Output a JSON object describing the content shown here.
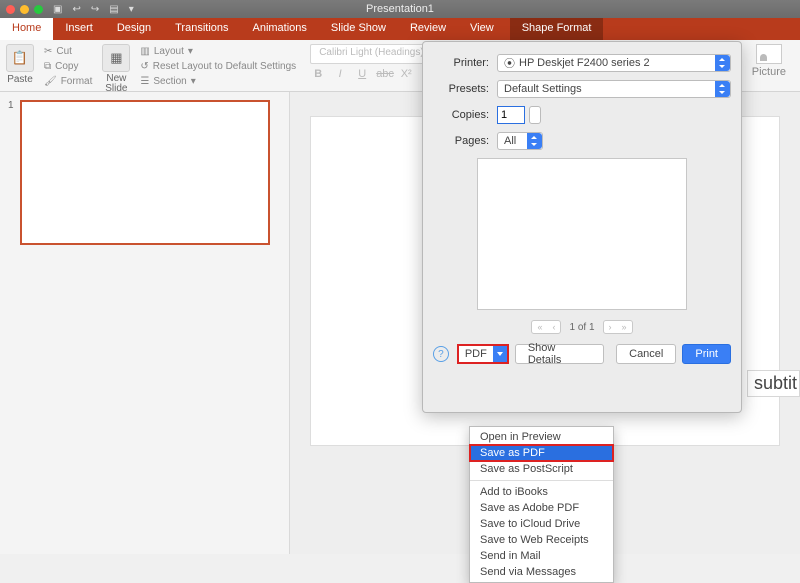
{
  "title": "Presentation1",
  "tabs": {
    "home": "Home",
    "insert": "Insert",
    "design": "Design",
    "transitions": "Transitions",
    "animations": "Animations",
    "slideshow": "Slide Show",
    "review": "Review",
    "view": "View",
    "shapeformat": "Shape Format"
  },
  "ribbon": {
    "paste": "Paste",
    "cut": "Cut",
    "copy": "Copy",
    "format": "Format",
    "newslide": "New\nSlide",
    "layout": "Layout",
    "reset": "Reset Layout to Default Settings",
    "section": "Section",
    "font": "Calibri Light (Headings)",
    "picture": "Picture",
    "b": "B",
    "i": "I",
    "u": "U",
    "s": "abc",
    "x2": "X²"
  },
  "thumb_num": "1",
  "subtitle": "subtit",
  "print": {
    "printer_label": "Printer:",
    "printer": "HP Deskjet F2400 series 2",
    "presets_label": "Presets:",
    "presets": "Default Settings",
    "copies_label": "Copies:",
    "copies": "1",
    "pages_label": "Pages:",
    "pages": "All",
    "page_of": "1 of 1",
    "pdf": "PDF",
    "show_details": "Show Details",
    "cancel": "Cancel",
    "print": "Print",
    "help": "?"
  },
  "pdf_menu": {
    "open": "Open in Preview",
    "save": "Save as PDF",
    "ps": "Save as PostScript",
    "ibooks": "Add to iBooks",
    "adobe": "Save as Adobe PDF",
    "icloud": "Save to iCloud Drive",
    "web": "Save to Web Receipts",
    "mail": "Send in Mail",
    "msg": "Send via Messages"
  }
}
